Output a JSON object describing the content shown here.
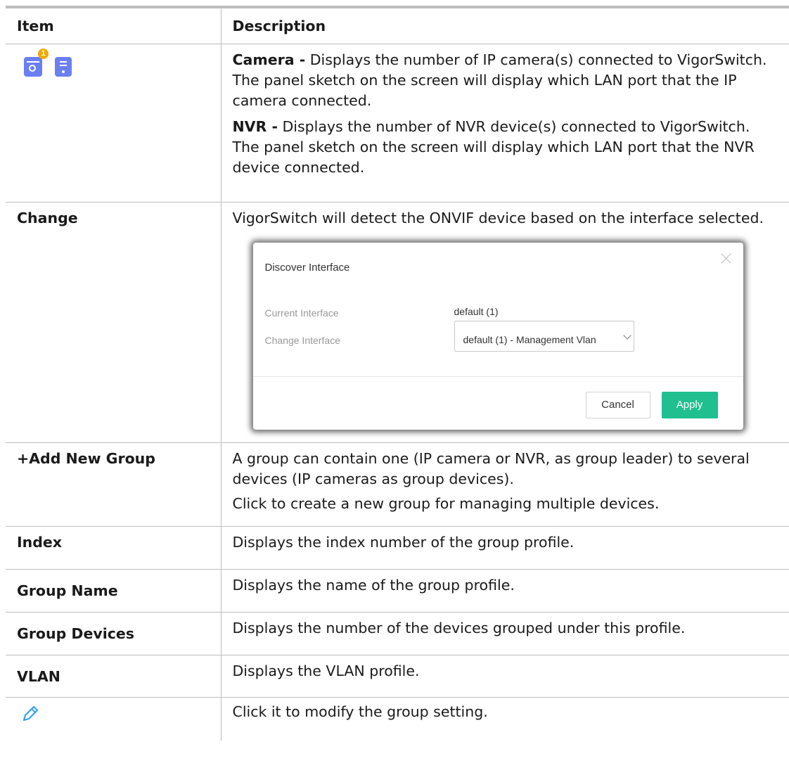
{
  "table": {
    "header": {
      "item": "Item",
      "description": "Description"
    },
    "rows": {
      "icons": {
        "camera_badge": "1",
        "camera_label": "Camera -",
        "camera_text": " Displays the number of IP camera(s) connected to VigorSwitch. The panel sketch on the screen will display which LAN port that the IP camera connected.",
        "nvr_label": "NVR -",
        "nvr_text": " Displays the number of NVR device(s) connected to VigorSwitch. The panel sketch on the screen will display which LAN port that the NVR device connected."
      },
      "change": {
        "item": "Change",
        "description": "VigorSwitch will detect the ONVIF device based on the interface selected.",
        "dialog": {
          "title": "Discover Interface",
          "current_label": "Current Interface",
          "current_value": "default (1)",
          "change_label": "Change Interface",
          "change_value": "default (1) - Management Vlan",
          "cancel": "Cancel",
          "apply": "Apply"
        }
      },
      "add_group": {
        "item": "+Add New Group",
        "description_1": "A group can contain one (IP camera or NVR, as group leader) to several devices (IP cameras as group devices).",
        "description_2": "Click to create a new group for managing multiple devices."
      },
      "index": {
        "item": "Index",
        "description": "Displays the index number of the group profile."
      },
      "group_name": {
        "item": "Group Name",
        "description": "Displays the name of the group profile."
      },
      "group_devices": {
        "item": "Group Devices",
        "description": "Displays the number of the devices grouped under this profile."
      },
      "vlan": {
        "item": "VLAN",
        "description": "Displays the VLAN profile."
      },
      "edit": {
        "description": "Click it to modify the group setting."
      }
    }
  },
  "colors": {
    "icon_accent": "#6b7ff2",
    "badge": "#f2a900",
    "apply_button": "#1fbf8f",
    "pencil": "#3aa0e8"
  },
  "icons": [
    "camera-icon",
    "nvr-icon",
    "pencil-icon",
    "close-icon",
    "chevron-down-icon"
  ]
}
